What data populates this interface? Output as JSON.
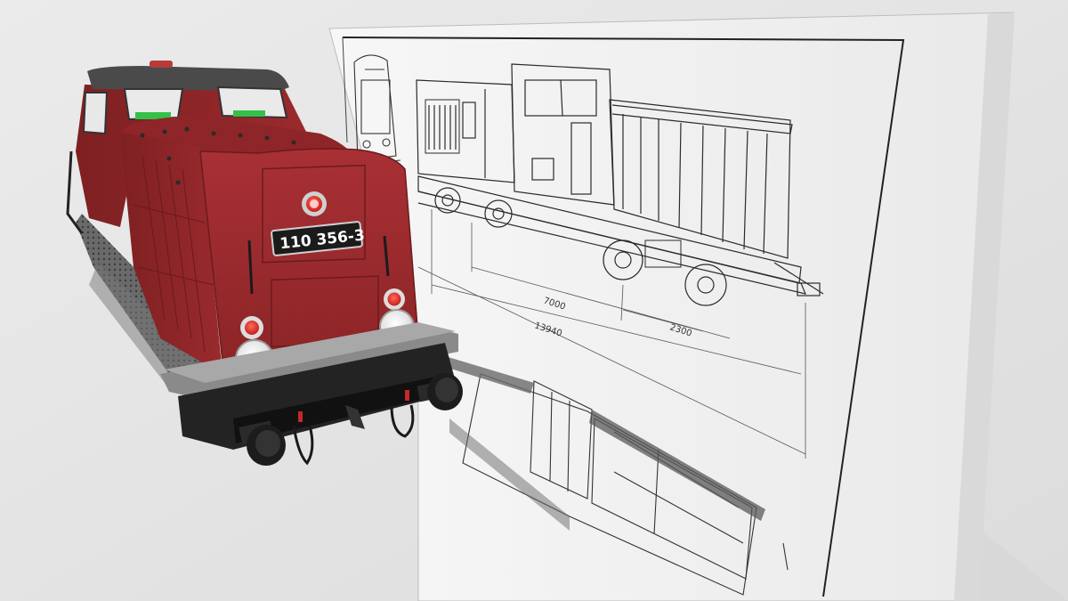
{
  "scene": {
    "description_colors": {
      "background": "#e4e4e4",
      "body_red": "#9b2a2c",
      "roof_dark": "#4a4a4a",
      "frame_gray": "#8a8a8a",
      "blueprint_line": "#2b2b2b",
      "blueprint_board": "#f2f2f2"
    }
  },
  "locomotive": {
    "number_plate": "110 356-3"
  },
  "blueprint": {
    "dimensions": [
      "7000",
      "2300",
      "13940"
    ]
  }
}
